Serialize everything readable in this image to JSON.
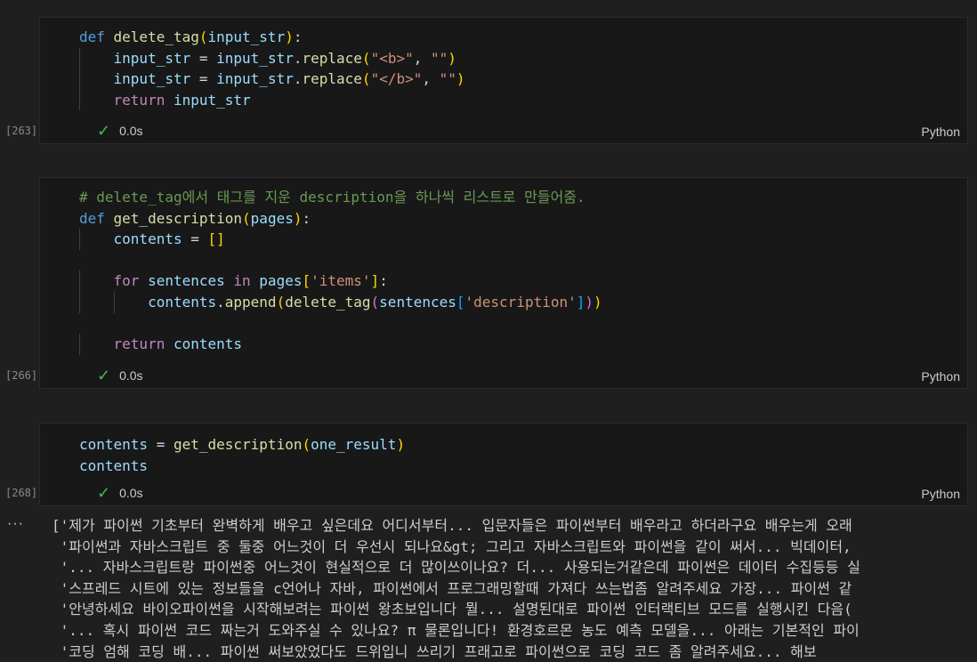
{
  "cells": [
    {
      "exec_count": "[263]",
      "time": "0.0s",
      "language": "Python",
      "code": [
        [
          {
            "t": "def ",
            "c": "kw"
          },
          {
            "t": "delete_tag",
            "c": "fn"
          },
          {
            "t": "(",
            "c": "p1"
          },
          {
            "t": "input_str",
            "c": "var"
          },
          {
            "t": ")",
            "c": "p1"
          },
          {
            "t": ":",
            "c": "op"
          }
        ],
        [
          {
            "t": "    "
          },
          {
            "t": "input_str",
            "c": "var"
          },
          {
            "t": " = ",
            "c": "op"
          },
          {
            "t": "input_str",
            "c": "var"
          },
          {
            "t": ".",
            "c": "op"
          },
          {
            "t": "replace",
            "c": "fn"
          },
          {
            "t": "(",
            "c": "p1"
          },
          {
            "t": "\"<b>\"",
            "c": "str"
          },
          {
            "t": ", ",
            "c": "op"
          },
          {
            "t": "\"\"",
            "c": "str"
          },
          {
            "t": ")",
            "c": "p1"
          }
        ],
        [
          {
            "t": "    "
          },
          {
            "t": "input_str",
            "c": "var"
          },
          {
            "t": " = ",
            "c": "op"
          },
          {
            "t": "input_str",
            "c": "var"
          },
          {
            "t": ".",
            "c": "op"
          },
          {
            "t": "replace",
            "c": "fn"
          },
          {
            "t": "(",
            "c": "p1"
          },
          {
            "t": "\"</b>\"",
            "c": "str"
          },
          {
            "t": ", ",
            "c": "op"
          },
          {
            "t": "\"\"",
            "c": "str"
          },
          {
            "t": ")",
            "c": "p1"
          }
        ],
        [
          {
            "t": "    "
          },
          {
            "t": "return ",
            "c": "ctl"
          },
          {
            "t": "input_str",
            "c": "var"
          }
        ]
      ]
    },
    {
      "exec_count": "[266]",
      "time": "0.0s",
      "language": "Python",
      "code": [
        [
          {
            "t": "# delete_tag에서 태그를 지운 description을 하나씩 리스트로 만들어줌.",
            "c": "cmt"
          }
        ],
        [
          {
            "t": "def ",
            "c": "kw"
          },
          {
            "t": "get_description",
            "c": "fn"
          },
          {
            "t": "(",
            "c": "p1"
          },
          {
            "t": "pages",
            "c": "var"
          },
          {
            "t": ")",
            "c": "p1"
          },
          {
            "t": ":",
            "c": "op"
          }
        ],
        [
          {
            "t": "    "
          },
          {
            "t": "contents",
            "c": "var"
          },
          {
            "t": " = ",
            "c": "op"
          },
          {
            "t": "[]",
            "c": "p1"
          }
        ],
        [
          {
            "t": ""
          }
        ],
        [
          {
            "t": "    "
          },
          {
            "t": "for ",
            "c": "ctl"
          },
          {
            "t": "sentences",
            "c": "var"
          },
          {
            "t": " in ",
            "c": "ctl"
          },
          {
            "t": "pages",
            "c": "var"
          },
          {
            "t": "[",
            "c": "p1"
          },
          {
            "t": "'items'",
            "c": "str"
          },
          {
            "t": "]",
            "c": "p1"
          },
          {
            "t": ":",
            "c": "op"
          }
        ],
        [
          {
            "t": "        "
          },
          {
            "t": "contents",
            "c": "var"
          },
          {
            "t": ".",
            "c": "op"
          },
          {
            "t": "append",
            "c": "fn"
          },
          {
            "t": "(",
            "c": "p1"
          },
          {
            "t": "delete_tag",
            "c": "fn"
          },
          {
            "t": "(",
            "c": "p2"
          },
          {
            "t": "sentences",
            "c": "var"
          },
          {
            "t": "[",
            "c": "p3"
          },
          {
            "t": "'description'",
            "c": "str"
          },
          {
            "t": "]",
            "c": "p3"
          },
          {
            "t": ")",
            "c": "p2"
          },
          {
            "t": ")",
            "c": "p1"
          }
        ],
        [
          {
            "t": ""
          }
        ],
        [
          {
            "t": "    "
          },
          {
            "t": "return ",
            "c": "ctl"
          },
          {
            "t": "contents",
            "c": "var"
          }
        ]
      ]
    },
    {
      "exec_count": "[268]",
      "time": "0.0s",
      "language": "Python",
      "code": [
        [
          {
            "t": "contents",
            "c": "var"
          },
          {
            "t": " = ",
            "c": "op"
          },
          {
            "t": "get_description",
            "c": "fn"
          },
          {
            "t": "(",
            "c": "p1"
          },
          {
            "t": "one_result",
            "c": "var"
          },
          {
            "t": ")",
            "c": "p1"
          }
        ],
        [
          {
            "t": "contents",
            "c": "var"
          }
        ]
      ]
    }
  ],
  "output": {
    "more_icon": "ellipsis-icon",
    "lines": [
      "['제가 파이썬 기초부터 완벽하게 배우고 싶은데요 어디서부터... 입문자들은 파이썬부터 배우라고 하더라구요 배우는게 오래",
      " '파이썬과 자바스크립트 중 둘중 어느것이 더 우선시 되나요&gt; 그리고 자바스크립트와 파이썬을 같이 써서... 빅데이터, ",
      " '... 자바스크립트랑 파이썬중 어느것이 현실적으로 더 많이쓰이나요? 더... 사용되는거같은데 파이썬은 데이터 수집등등 실",
      " '스프레드 시트에 있는 정보들을 c언어나 자바, 파이썬에서 프로그래밍할때 가져다 쓰는법좀 알려주세요 가장... 파이썬 같",
      " '안녕하세요 바이오파이썬을 시작해보려는 파이썬 왕초보입니다 뭘... 설명된대로 파이썬 인터랙티브 모드를 실행시킨 다음(",
      " '... 혹시 파이썬 코드 짜는거 도와주실 수 있나요? π 물론입니다! 환경호르몬 농도 예측 모델을... 아래는 기본적인 파이",
      " '코딩 엄해 코딩 배... 파이썬 써보았었다도 드위입니 쓰리기 프래고로 파이썬으로 코딩 코드 좀 알려주세요... 해보"
    ]
  }
}
